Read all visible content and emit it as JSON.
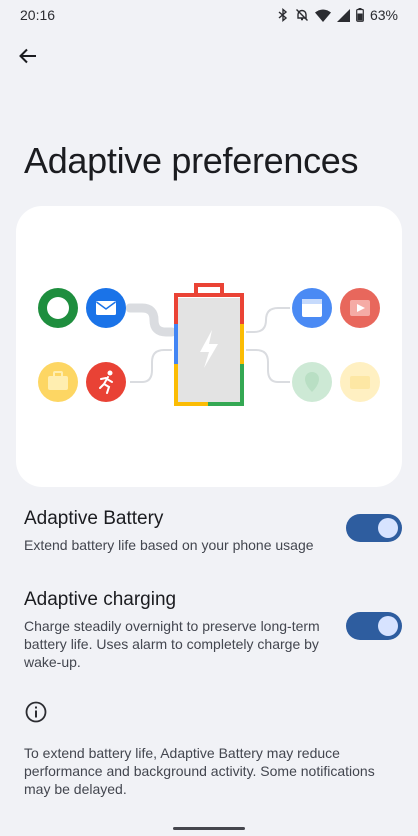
{
  "status_bar": {
    "time": "20:16",
    "battery_percent": "63%",
    "icons": [
      "bluetooth-icon",
      "notifications-off-icon",
      "wifi-icon",
      "cell-signal-icon",
      "battery-icon"
    ]
  },
  "header": {
    "back_icon": "arrow-back-icon",
    "title": "Adaptive preferences"
  },
  "illustration": {
    "left_apps": [
      "messages-icon",
      "email-icon",
      "briefcase-icon",
      "running-icon"
    ],
    "right_apps": [
      "calendar-icon",
      "video-icon",
      "maps-icon",
      "card-icon"
    ],
    "center": "charging-battery-icon"
  },
  "settings": [
    {
      "title": "Adaptive Battery",
      "description": "Extend battery life based on your phone usage",
      "enabled": true
    },
    {
      "title": "Adaptive charging",
      "description": "Charge steadily overnight to preserve long-term battery life. Uses alarm to completely charge by wake-up.",
      "enabled": true
    }
  ],
  "footer": {
    "icon": "info-icon",
    "text": "To extend battery life, Adaptive Battery may reduce performance and background activity. Some notifications may be delayed."
  },
  "colors": {
    "background": "#f1f2f6",
    "toggle_track": "#2e5d9f",
    "toggle_thumb": "#d7e3ff"
  }
}
